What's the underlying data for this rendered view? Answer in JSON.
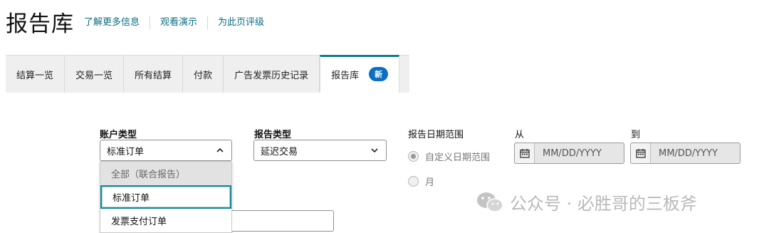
{
  "header": {
    "title": "报告库",
    "links": [
      "了解更多信息",
      "观看演示",
      "为此页评级"
    ]
  },
  "tabs": [
    {
      "label": "结算一览"
    },
    {
      "label": "交易一览"
    },
    {
      "label": "所有结算"
    },
    {
      "label": "付款"
    },
    {
      "label": "广告发票历史记录"
    },
    {
      "label": "报告库",
      "badge": "新",
      "active": true
    }
  ],
  "filters": {
    "account_type": {
      "label": "账户类型",
      "value": "标准订单",
      "options": [
        "全部（联合报告）",
        "标准订单",
        "发票支付订单"
      ]
    },
    "report_type": {
      "label": "报告类型",
      "value": "延迟交易"
    },
    "date_range": {
      "label": "报告日期范围",
      "options": [
        "自定义日期范围",
        "月"
      ]
    },
    "from": {
      "label": "从",
      "placeholder": "MM/DD/YYYY"
    },
    "to": {
      "label": "到",
      "placeholder": "MM/DD/YYYY"
    }
  },
  "watermark": {
    "text": "公众号 · 必胜哥的三板斧"
  },
  "colors": {
    "accent": "#0f7c90",
    "link": "#0a6d83",
    "badge": "#0a6fc2"
  }
}
